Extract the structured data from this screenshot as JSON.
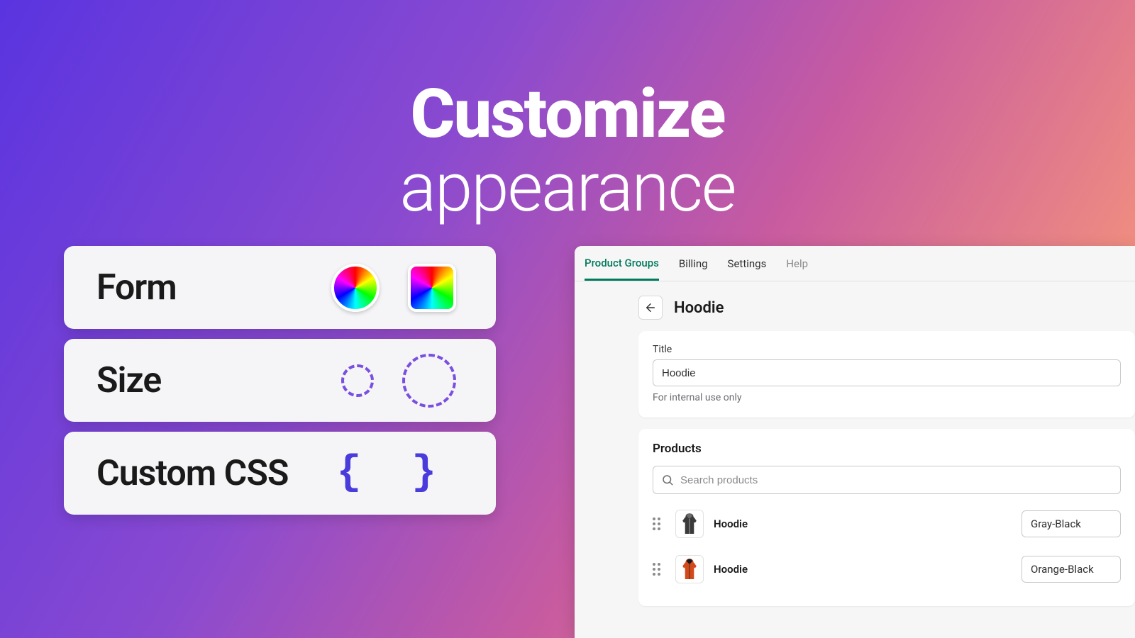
{
  "hero": {
    "line1": "Customize",
    "line2": "appearance"
  },
  "cards": {
    "form": "Form",
    "size": "Size",
    "css": "Custom CSS",
    "css_glyph": "{ }"
  },
  "panel": {
    "tabs": [
      {
        "label": "Product Groups",
        "state": "active"
      },
      {
        "label": "Billing",
        "state": ""
      },
      {
        "label": "Settings",
        "state": ""
      },
      {
        "label": "Help",
        "state": "muted"
      }
    ],
    "page_title": "Hoodie",
    "title_section": {
      "label": "Title",
      "value": "Hoodie",
      "helper": "For internal use only"
    },
    "products_section": {
      "title": "Products",
      "search_placeholder": "Search products",
      "rows": [
        {
          "name": "Hoodie",
          "variant": "Gray-Black",
          "thumb": "gray"
        },
        {
          "name": "Hoodie",
          "variant": "Orange-Black",
          "thumb": "orange"
        }
      ]
    }
  }
}
